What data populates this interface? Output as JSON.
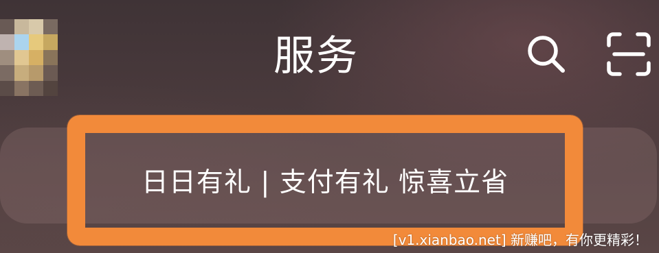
{
  "header": {
    "title": "服务",
    "search_icon": "search-icon",
    "scan_icon": "scan-icon"
  },
  "avatar": {
    "style": "pixelated",
    "pixels": [
      [
        "#6a5a55",
        "#c9b89a",
        "#d9c9a8",
        "#7a6a60"
      ],
      [
        "#bfb3b0",
        "#a9d4f0",
        "#e8c978",
        "#c8a85c"
      ],
      [
        "#a08e7e",
        "#e2c78f",
        "#d8b060",
        "#8a7458"
      ],
      [
        "#7c6b62",
        "#c8ad7a",
        "#b89a68",
        "#6c5a52"
      ],
      [
        "#5c4c48",
        "#8a7462",
        "#6e5c52",
        "#54443f"
      ]
    ]
  },
  "promo": {
    "text": "日日有礼 | 支付有礼 惊喜立省"
  },
  "watermark": {
    "text": "[v1.xianbao.net] 新赚吧，有你更精彩！"
  },
  "colors": {
    "highlight": "#f28a3a",
    "text": "#ffffff"
  }
}
